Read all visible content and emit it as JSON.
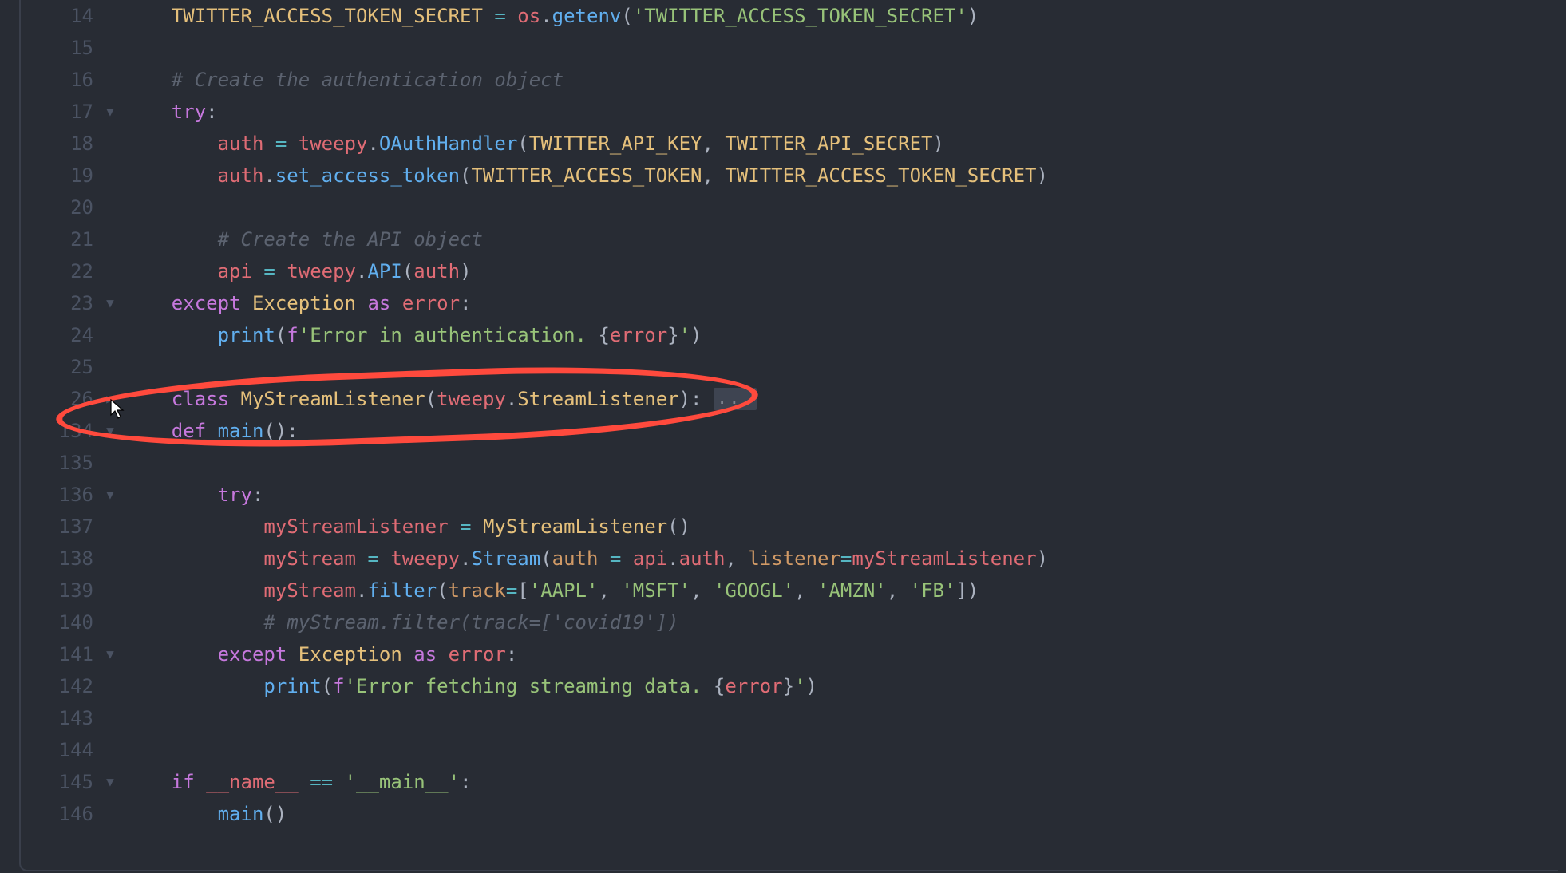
{
  "lines": [
    {
      "num": "14",
      "fold": "",
      "tokens": [
        [
          "",
          "    "
        ],
        [
          "cls",
          "TWITTER_ACCESS_TOKEN_SECRET"
        ],
        [
          "pn",
          " "
        ],
        [
          "op",
          "="
        ],
        [
          "pn",
          " "
        ],
        [
          "var",
          "os"
        ],
        [
          "pn",
          "."
        ],
        [
          "func",
          "getenv"
        ],
        [
          "pn",
          "("
        ],
        [
          "str",
          "'TWITTER_ACCESS_TOKEN_SECRET'"
        ],
        [
          "pn",
          ")"
        ]
      ]
    },
    {
      "num": "15",
      "fold": "",
      "tokens": [
        [
          "",
          ""
        ]
      ]
    },
    {
      "num": "16",
      "fold": "",
      "tokens": [
        [
          "",
          "    "
        ],
        [
          "cmt",
          "# Create the authentication object"
        ]
      ]
    },
    {
      "num": "17",
      "fold": "down",
      "tokens": [
        [
          "",
          "    "
        ],
        [
          "kw",
          "try"
        ],
        [
          "pn",
          ":"
        ]
      ]
    },
    {
      "num": "18",
      "fold": "",
      "tokens": [
        [
          "",
          "        "
        ],
        [
          "var",
          "auth"
        ],
        [
          "pn",
          " "
        ],
        [
          "op",
          "="
        ],
        [
          "pn",
          " "
        ],
        [
          "var",
          "tweepy"
        ],
        [
          "pn",
          "."
        ],
        [
          "func",
          "OAuthHandler"
        ],
        [
          "pn",
          "("
        ],
        [
          "cls",
          "TWITTER_API_KEY"
        ],
        [
          "pn",
          ", "
        ],
        [
          "cls",
          "TWITTER_API_SECRET"
        ],
        [
          "pn",
          ")"
        ]
      ]
    },
    {
      "num": "19",
      "fold": "",
      "tokens": [
        [
          "",
          "        "
        ],
        [
          "var",
          "auth"
        ],
        [
          "pn",
          "."
        ],
        [
          "func",
          "set_access_token"
        ],
        [
          "pn",
          "("
        ],
        [
          "cls",
          "TWITTER_ACCESS_TOKEN"
        ],
        [
          "pn",
          ", "
        ],
        [
          "cls",
          "TWITTER_ACCESS_TOKEN_SECRET"
        ],
        [
          "pn",
          ")"
        ]
      ]
    },
    {
      "num": "20",
      "fold": "",
      "tokens": [
        [
          "",
          ""
        ]
      ]
    },
    {
      "num": "21",
      "fold": "",
      "tokens": [
        [
          "",
          "        "
        ],
        [
          "cmt",
          "# Create the API object"
        ]
      ]
    },
    {
      "num": "22",
      "fold": "",
      "tokens": [
        [
          "",
          "        "
        ],
        [
          "var",
          "api"
        ],
        [
          "pn",
          " "
        ],
        [
          "op",
          "="
        ],
        [
          "pn",
          " "
        ],
        [
          "var",
          "tweepy"
        ],
        [
          "pn",
          "."
        ],
        [
          "func",
          "API"
        ],
        [
          "pn",
          "("
        ],
        [
          "var",
          "auth"
        ],
        [
          "pn",
          ")"
        ]
      ]
    },
    {
      "num": "23",
      "fold": "down",
      "tokens": [
        [
          "",
          "    "
        ],
        [
          "kw",
          "except"
        ],
        [
          "pn",
          " "
        ],
        [
          "cls",
          "Exception"
        ],
        [
          "pn",
          " "
        ],
        [
          "kw",
          "as"
        ],
        [
          "pn",
          " "
        ],
        [
          "var",
          "error"
        ],
        [
          "pn",
          ":"
        ]
      ]
    },
    {
      "num": "24",
      "fold": "",
      "tokens": [
        [
          "",
          "        "
        ],
        [
          "func",
          "print"
        ],
        [
          "pn",
          "("
        ],
        [
          "kw",
          "f"
        ],
        [
          "str",
          "'Error in authentication. "
        ],
        [
          "pn",
          "{"
        ],
        [
          "var",
          "error"
        ],
        [
          "pn",
          "}"
        ],
        [
          "str",
          "'"
        ],
        [
          "pn",
          ")"
        ]
      ]
    },
    {
      "num": "25",
      "fold": "",
      "tokens": [
        [
          "",
          ""
        ]
      ]
    },
    {
      "num": "26",
      "fold": "right",
      "tokens": [
        [
          "",
          "    "
        ],
        [
          "kw",
          "class"
        ],
        [
          "pn",
          " "
        ],
        [
          "cls",
          "MyStreamListener"
        ],
        [
          "pn",
          "("
        ],
        [
          "var",
          "tweepy"
        ],
        [
          "pn",
          "."
        ],
        [
          "cls",
          "StreamListener"
        ],
        [
          "pn",
          "):"
        ],
        [
          "fold-ellipsis",
          "..."
        ]
      ]
    },
    {
      "num": "134",
      "fold": "down",
      "tokens": [
        [
          "",
          "    "
        ],
        [
          "kw",
          "def"
        ],
        [
          "pn",
          " "
        ],
        [
          "func",
          "main"
        ],
        [
          "pn",
          "():"
        ]
      ]
    },
    {
      "num": "135",
      "fold": "",
      "tokens": [
        [
          "",
          ""
        ]
      ]
    },
    {
      "num": "136",
      "fold": "down",
      "tokens": [
        [
          "",
          "        "
        ],
        [
          "kw",
          "try"
        ],
        [
          "pn",
          ":"
        ]
      ]
    },
    {
      "num": "137",
      "fold": "",
      "tokens": [
        [
          "",
          "            "
        ],
        [
          "var",
          "myStreamListener"
        ],
        [
          "pn",
          " "
        ],
        [
          "op",
          "="
        ],
        [
          "pn",
          " "
        ],
        [
          "cls",
          "MyStreamListener"
        ],
        [
          "pn",
          "()"
        ]
      ]
    },
    {
      "num": "138",
      "fold": "",
      "tokens": [
        [
          "",
          "            "
        ],
        [
          "var",
          "myStream"
        ],
        [
          "pn",
          " "
        ],
        [
          "op",
          "="
        ],
        [
          "pn",
          " "
        ],
        [
          "var",
          "tweepy"
        ],
        [
          "pn",
          "."
        ],
        [
          "func",
          "Stream"
        ],
        [
          "pn",
          "("
        ],
        [
          "self",
          "auth"
        ],
        [
          "pn",
          " "
        ],
        [
          "op",
          "="
        ],
        [
          "pn",
          " "
        ],
        [
          "var",
          "api"
        ],
        [
          "pn",
          "."
        ],
        [
          "var",
          "auth"
        ],
        [
          "pn",
          ", "
        ],
        [
          "self",
          "listener"
        ],
        [
          "op",
          "="
        ],
        [
          "var",
          "myStreamListener"
        ],
        [
          "pn",
          ")"
        ]
      ]
    },
    {
      "num": "139",
      "fold": "",
      "tokens": [
        [
          "",
          "            "
        ],
        [
          "var",
          "myStream"
        ],
        [
          "pn",
          "."
        ],
        [
          "func",
          "filter"
        ],
        [
          "pn",
          "("
        ],
        [
          "self",
          "track"
        ],
        [
          "op",
          "="
        ],
        [
          "pn",
          "["
        ],
        [
          "str",
          "'AAPL'"
        ],
        [
          "pn",
          ", "
        ],
        [
          "str",
          "'MSFT'"
        ],
        [
          "pn",
          ", "
        ],
        [
          "str",
          "'GOOGL'"
        ],
        [
          "pn",
          ", "
        ],
        [
          "str",
          "'AMZN'"
        ],
        [
          "pn",
          ", "
        ],
        [
          "str",
          "'FB'"
        ],
        [
          "pn",
          "])"
        ]
      ]
    },
    {
      "num": "140",
      "fold": "",
      "tokens": [
        [
          "",
          "            "
        ],
        [
          "cmt",
          "# myStream.filter(track=['covid19'])"
        ]
      ]
    },
    {
      "num": "141",
      "fold": "down",
      "tokens": [
        [
          "",
          "        "
        ],
        [
          "kw",
          "except"
        ],
        [
          "pn",
          " "
        ],
        [
          "cls",
          "Exception"
        ],
        [
          "pn",
          " "
        ],
        [
          "kw",
          "as"
        ],
        [
          "pn",
          " "
        ],
        [
          "var",
          "error"
        ],
        [
          "pn",
          ":"
        ]
      ]
    },
    {
      "num": "142",
      "fold": "",
      "tokens": [
        [
          "",
          "            "
        ],
        [
          "func",
          "print"
        ],
        [
          "pn",
          "("
        ],
        [
          "kw",
          "f"
        ],
        [
          "str",
          "'Error fetching streaming data. "
        ],
        [
          "pn",
          "{"
        ],
        [
          "var",
          "error"
        ],
        [
          "pn",
          "}"
        ],
        [
          "str",
          "'"
        ],
        [
          "pn",
          ")"
        ]
      ]
    },
    {
      "num": "143",
      "fold": "",
      "tokens": [
        [
          "",
          ""
        ]
      ]
    },
    {
      "num": "144",
      "fold": "",
      "tokens": [
        [
          "",
          ""
        ]
      ]
    },
    {
      "num": "145",
      "fold": "down",
      "tokens": [
        [
          "",
          "    "
        ],
        [
          "kw",
          "if"
        ],
        [
          "pn",
          " "
        ],
        [
          "var",
          "__name__"
        ],
        [
          "pn",
          " "
        ],
        [
          "op",
          "=="
        ],
        [
          "pn",
          " "
        ],
        [
          "str",
          "'__main__'"
        ],
        [
          "pn",
          ":"
        ]
      ]
    },
    {
      "num": "146",
      "fold": "",
      "tokens": [
        [
          "",
          "        "
        ],
        [
          "func",
          "main"
        ],
        [
          "pn",
          "()"
        ]
      ]
    }
  ],
  "annotation": {
    "present": true
  }
}
